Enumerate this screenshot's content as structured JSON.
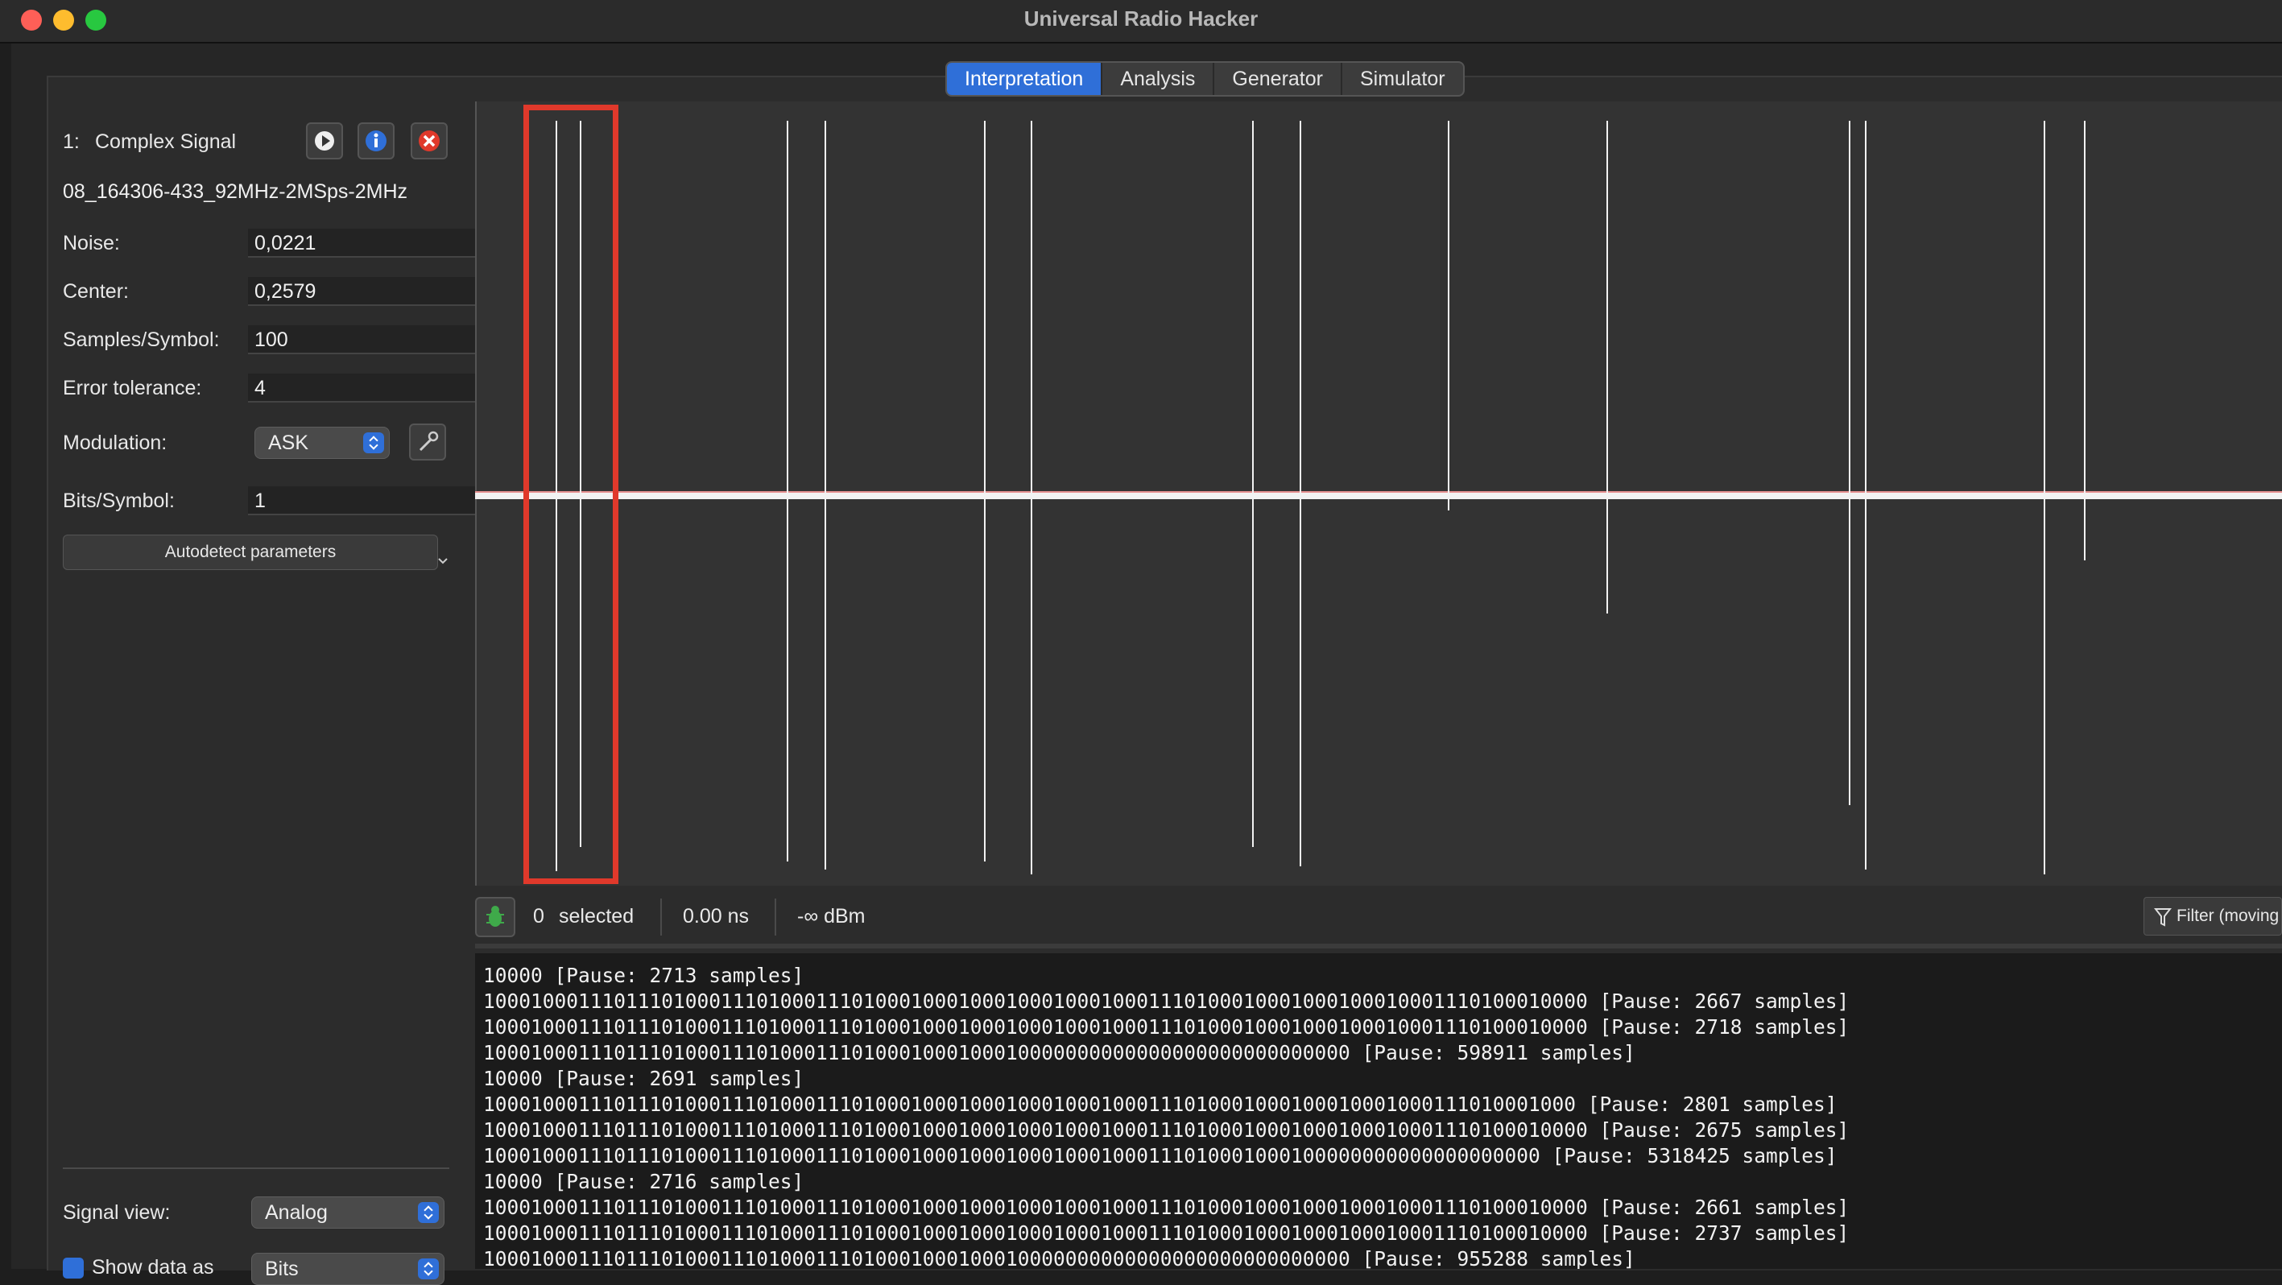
{
  "window": {
    "title": "Universal Radio Hacker"
  },
  "tabs": [
    {
      "label": "Interpretation",
      "active": true
    },
    {
      "label": "Analysis",
      "active": false
    },
    {
      "label": "Generator",
      "active": false
    },
    {
      "label": "Simulator",
      "active": false
    }
  ],
  "signal": {
    "index": "1:",
    "name": "Complex Signal",
    "filename": "08_164306-433_92MHz-2MSps-2MHz"
  },
  "params": {
    "noise_label": "Noise:",
    "noise_value": "0,0221",
    "center_label": "Center:",
    "center_value": "0,2579",
    "sps_label": "Samples/Symbol:",
    "sps_value": "100",
    "tolerance_label": "Error tolerance:",
    "tolerance_value": "4",
    "modulation_label": "Modulation:",
    "modulation_value": "ASK",
    "bits_label": "Bits/Symbol:",
    "bits_value": "1"
  },
  "autodetect_label": "Autodetect parameters",
  "signal_view": {
    "label": "Signal view:",
    "value": "Analog"
  },
  "show_data": {
    "label": "Show data as",
    "value": "Bits"
  },
  "status": {
    "selected_count": "0",
    "selected_label": "selected",
    "duration": "0.00 ns",
    "power": "-∞ dBm",
    "filter_label": "Filter (moving"
  },
  "console_lines": [
    "10000 [Pause: 2713 samples]",
    "100010001110111010001110100011101000100010001000100010001110100010001000100010001110100010000 [Pause: 2667 samples]",
    "100010001110111010001110100011101000100010001000100010001110100010001000100010001110100010000 [Pause: 2718 samples]",
    "1000100011101110100011101000111010001000100010000000000000000000000000000 [Pause: 598911 samples]",
    "10000 [Pause: 2691 samples]",
    "10001000111011101000111010001110100010001000100010001000111010001000100010001000111010001000 [Pause: 2801 samples]",
    "100010001110111010001110100011101000100010001000100010001110100010001000100010001110100010000 [Pause: 2675 samples]",
    "10001000111011101000111010001110100010001000100010001000111010001000100000000000000000000 [Pause: 5318425 samples]",
    "10000 [Pause: 2716 samples]",
    "100010001110111010001110100011101000100010001000100010001110100010001000100010001110100010000 [Pause: 2661 samples]",
    "100010001110111010001110100011101000100010001000100010001110100010001000100010001110100010000 [Pause: 2737 samples]",
    "1000100011101110100011101000111010001000100010000000000000000000000000000 [Pause: 955288 samples]"
  ],
  "icons": {
    "play": "play-icon",
    "info": "info-icon",
    "close": "close-icon",
    "wrench": "wrench-icon",
    "bug": "bug-icon",
    "filter": "filter-icon"
  }
}
